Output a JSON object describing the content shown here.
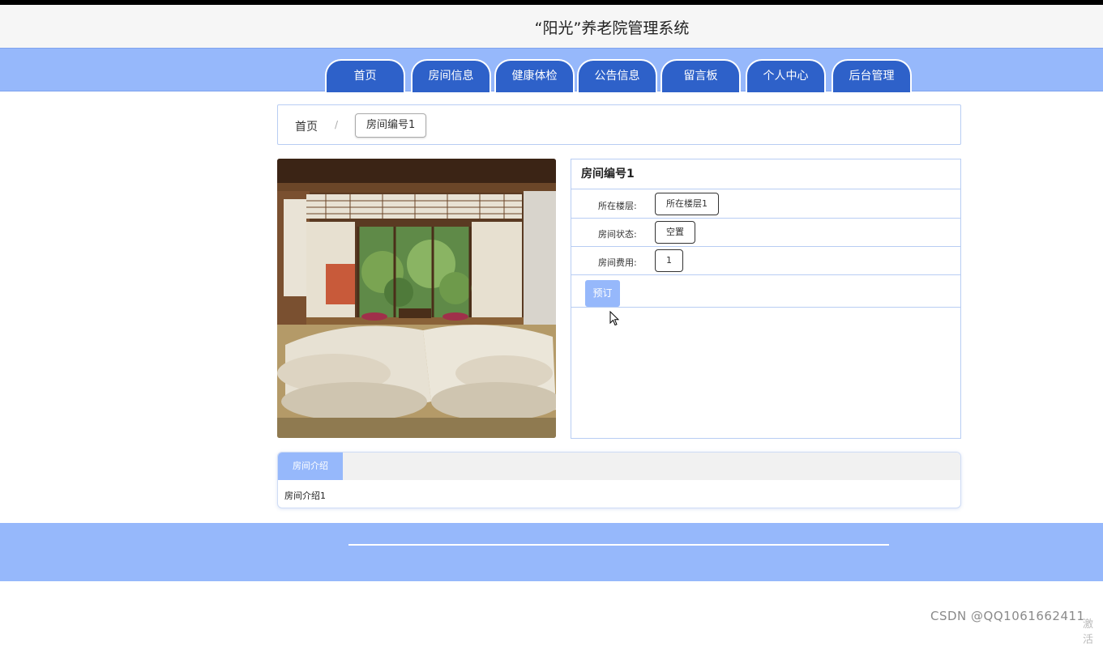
{
  "header": {
    "title": "“阳光”养老院管理系统"
  },
  "nav": {
    "items": [
      {
        "label": "首页"
      },
      {
        "label": "房间信息"
      },
      {
        "label": "健康体检"
      },
      {
        "label": "公告信息"
      },
      {
        "label": "留言板"
      },
      {
        "label": "个人中心"
      },
      {
        "label": "后台管理"
      }
    ]
  },
  "breadcrumb": {
    "home": "首页",
    "separator": "/",
    "current": "房间编号1"
  },
  "room": {
    "name": "房间编号1",
    "floor_label": "所在楼层:",
    "floor_value": "所在楼层1",
    "status_label": "房间状态:",
    "status_value": "空置",
    "fee_label": "房间费用:",
    "fee_value": "1",
    "book_label": "预订"
  },
  "intro": {
    "tab_label": "房间介绍",
    "text": "房间介绍1"
  },
  "watermark": {
    "text": "CSDN @QQ1061662411",
    "text2": "激活"
  },
  "colors": {
    "nav_blue": "#2e61c9",
    "light_blue": "#96b8fb",
    "border_blue": "#b8cdf3"
  }
}
